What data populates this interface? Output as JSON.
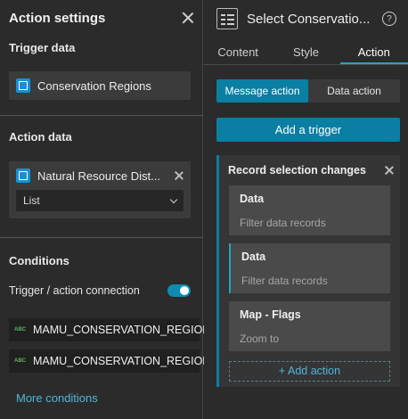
{
  "left_panel": {
    "title": "Action settings",
    "trigger_section": {
      "title": "Trigger data",
      "source": "Conservation Regions"
    },
    "action_section": {
      "title": "Action data",
      "source": "Natural Resource Dist...",
      "view_select": "List"
    },
    "conditions_section": {
      "title": "Conditions",
      "connection_label": "Trigger / action connection",
      "connection_enabled": true,
      "fields": [
        {
          "type_label": "ABC",
          "name": "MAMU_CONSERVATION_REGION"
        },
        {
          "type_label": "ABC",
          "name": "MAMU_CONSERVATION_REGION"
        }
      ],
      "more_link": "More conditions"
    }
  },
  "right_panel": {
    "title": "Select Conservatio...",
    "tabs": [
      {
        "label": "Content",
        "active": false
      },
      {
        "label": "Style",
        "active": false
      },
      {
        "label": "Action",
        "active": true
      }
    ],
    "segments": [
      {
        "label": "Message action",
        "active": true
      },
      {
        "label": "Data action",
        "active": false
      }
    ],
    "add_trigger_label": "Add a trigger",
    "trigger": {
      "title": "Record selection changes",
      "actions": [
        {
          "title": "Data",
          "subtitle": "Filter data records"
        },
        {
          "title": "Data",
          "subtitle": "Filter data records"
        },
        {
          "title": "Map - Flags",
          "subtitle": "Zoom to"
        }
      ],
      "add_action_label": "+ Add action"
    }
  },
  "colors": {
    "accent": "#0a7fa3",
    "link": "#4fb6d9",
    "panel_bg": "#2b2b2b",
    "datasource_icon": "#1b8fd6"
  }
}
